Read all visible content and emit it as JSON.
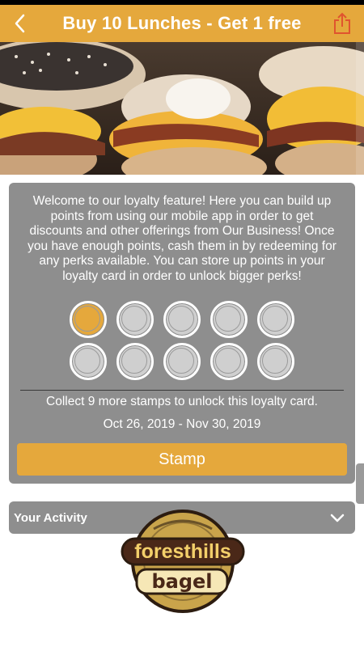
{
  "header": {
    "title": "Buy 10 Lunches - Get 1 free",
    "back_icon": "chevron-left-icon",
    "share_icon": "share-icon"
  },
  "loyalty": {
    "description": "Welcome to our loyalty feature! Here you can build up points from using our mobile app in order to get discounts and other offerings from Our Business! Once you have enough points, cash them in by redeeming for any perks available. You can store up points in your loyalty card in order to unlock bigger perks!",
    "stamps_total": 10,
    "stamps_collected": 1,
    "collect_message": "Collect 9 more stamps to unlock this loyalty card.",
    "date_range": "Oct 26, 2019 - Nov 30, 2019",
    "stamp_button": "Stamp"
  },
  "activity": {
    "label": "Your Activity",
    "toggle_icon": "chevron-down-icon"
  },
  "logo": {
    "line1": "foresthills",
    "line2": "bagel"
  },
  "colors": {
    "accent": "#e5a83c",
    "card": "#8e8e8e"
  }
}
